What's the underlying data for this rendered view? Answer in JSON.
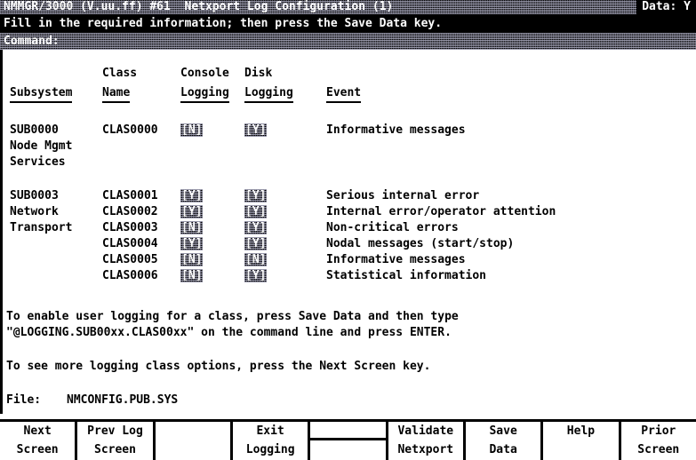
{
  "header": {
    "title": "NMMGR/3000 (V.uu.ff) #61  Netxport Log Configuration (1)",
    "data_flag": "Data: Y",
    "message": "Fill in the required information; then press the Save Data key.",
    "command_label": "Command:",
    "command_value": ""
  },
  "columns": {
    "line1": {
      "class": "Class",
      "console": "Console",
      "disk": "Disk"
    },
    "line2": {
      "subsystem": "Subsystem",
      "name": "Name",
      "console_logging": "Logging",
      "disk_logging": "Logging",
      "event": "Event"
    }
  },
  "groups": [
    {
      "subsystem_lines": [
        "SUB0000",
        "Node Mgmt",
        "Services"
      ],
      "rows": [
        {
          "class_name": "CLAS0000",
          "console_logging": "[N]",
          "disk_logging": "[Y]",
          "event": "Informative messages"
        }
      ]
    },
    {
      "subsystem_lines": [
        "SUB0003",
        "Network",
        "Transport"
      ],
      "rows": [
        {
          "class_name": "CLAS0001",
          "console_logging": "[Y]",
          "disk_logging": "[Y]",
          "event": "Serious internal error"
        },
        {
          "class_name": "CLAS0002",
          "console_logging": "[Y]",
          "disk_logging": "[Y]",
          "event": "Internal error/operator attention"
        },
        {
          "class_name": "CLAS0003",
          "console_logging": "[N]",
          "disk_logging": "[Y]",
          "event": "Non-critical errors"
        },
        {
          "class_name": "CLAS0004",
          "console_logging": "[Y]",
          "disk_logging": "[Y]",
          "event": "Nodal messages (start/stop)"
        },
        {
          "class_name": "CLAS0005",
          "console_logging": "[N]",
          "disk_logging": "[N]",
          "event": "Informative messages"
        },
        {
          "class_name": "CLAS0006",
          "console_logging": "[N]",
          "disk_logging": "[Y]",
          "event": "Statistical information"
        }
      ]
    }
  ],
  "notes": {
    "line1": "To enable user logging for a class, press Save Data and then type",
    "line2": "\"@LOGGING.SUB00xx.CLAS00xx\" on the command line and press ENTER.",
    "line3": "To see more logging class options, press the Next Screen key."
  },
  "file": {
    "label": "File:",
    "value": "NMCONFIG.PUB.SYS"
  },
  "function_keys": [
    {
      "line1": "Next",
      "line2": "Screen"
    },
    {
      "line1": "Prev Log",
      "line2": "Screen"
    },
    {
      "line1": "",
      "line2": ""
    },
    {
      "line1": "Exit",
      "line2": "Logging"
    },
    {
      "line1": "",
      "line2": ""
    },
    {
      "line1": "Validate",
      "line2": "Netxport"
    },
    {
      "line1": "Save",
      "line2": "Data"
    },
    {
      "line1": "Help",
      "line2": ""
    },
    {
      "line1": "Prior",
      "line2": "Screen"
    }
  ],
  "colors": {
    "background": "#ffffff",
    "foreground": "#000000",
    "inverse_text": "#ffffff",
    "inverse_background": "#000000"
  }
}
